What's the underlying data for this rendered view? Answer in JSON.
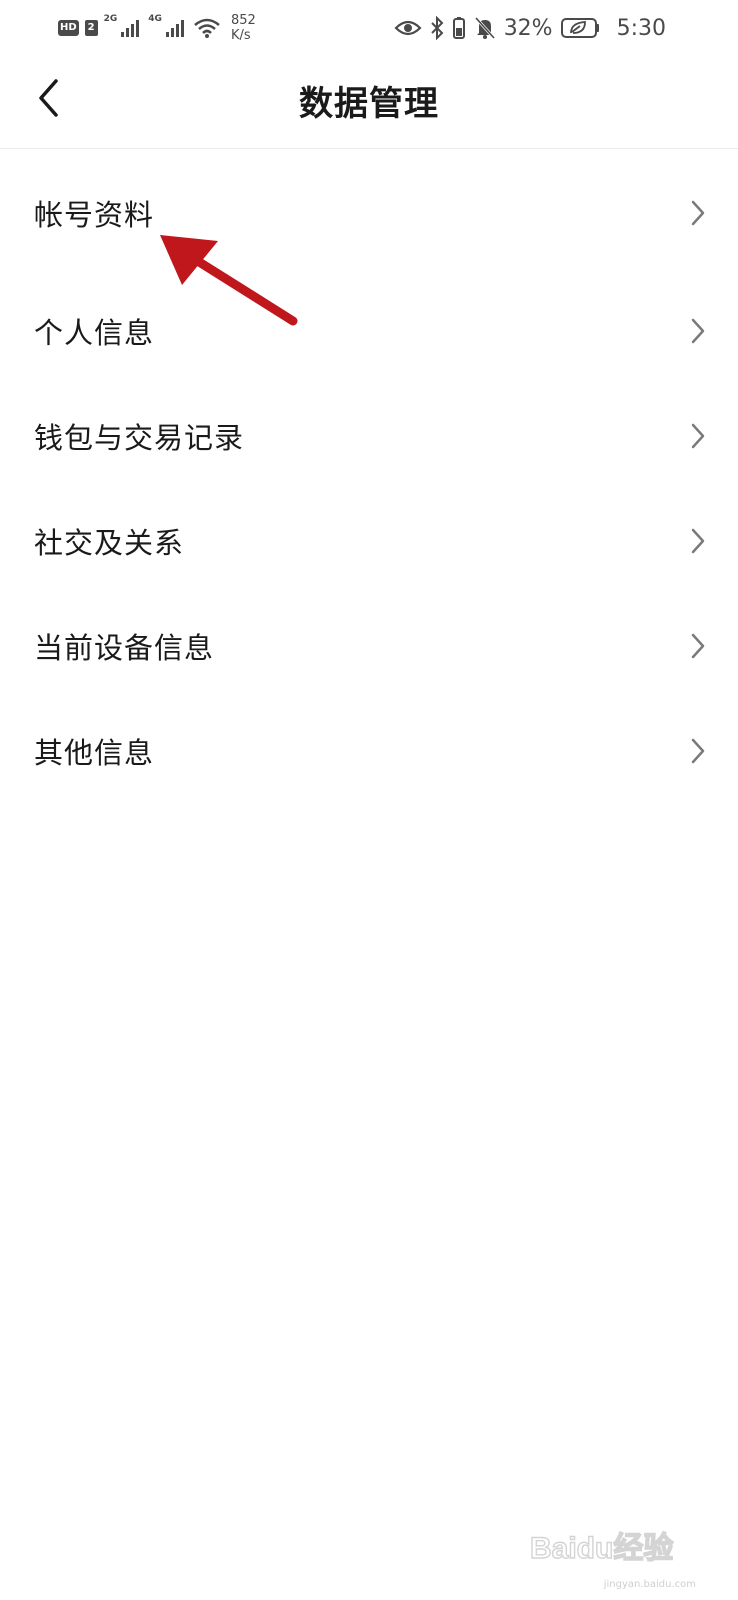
{
  "status_bar": {
    "hd_label": "HD",
    "sim_label": "2",
    "net1_label": "2G",
    "net2_label": "4G",
    "speed_value": "852",
    "speed_unit": "K/s",
    "battery_percent": "32%",
    "time": "5:30"
  },
  "header": {
    "title": "数据管理"
  },
  "menu": {
    "items": [
      {
        "label": "帐号资料"
      },
      {
        "label": "个人信息"
      },
      {
        "label": "钱包与交易记录"
      },
      {
        "label": "社交及关系"
      },
      {
        "label": "当前设备信息"
      },
      {
        "label": "其他信息"
      }
    ]
  },
  "annotation": {
    "arrow_color": "#c0171c"
  },
  "watermark": {
    "brand": "Baidu经验",
    "url": "jingyan.baidu.com"
  }
}
